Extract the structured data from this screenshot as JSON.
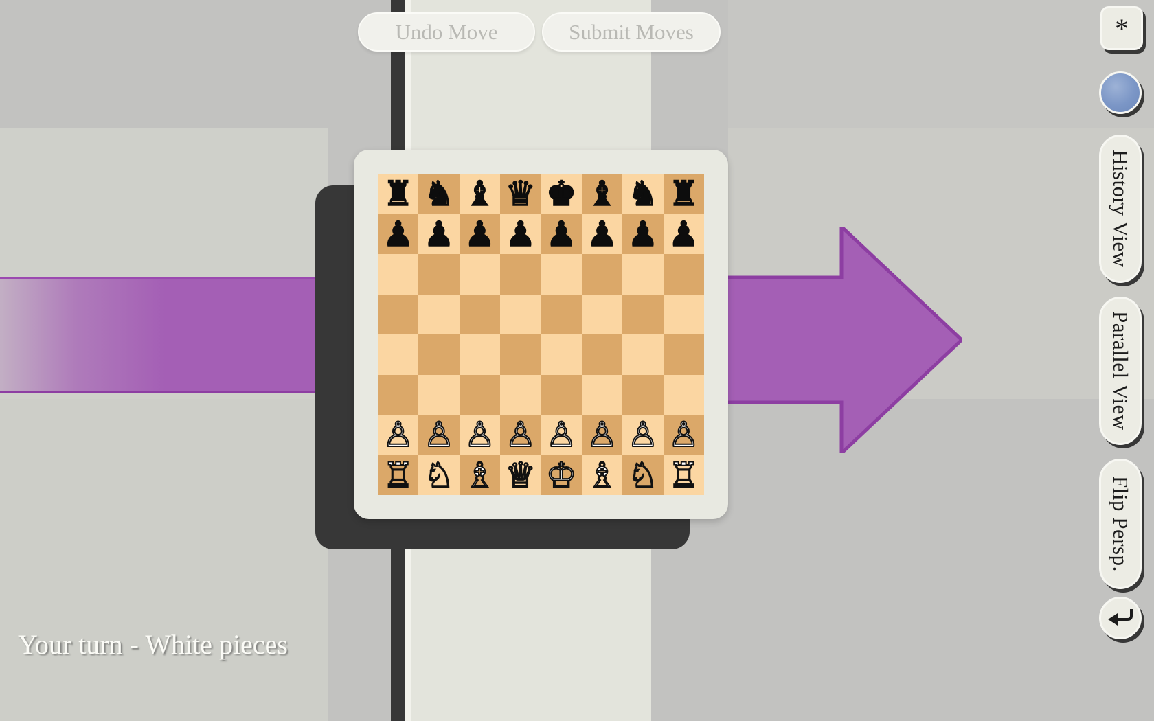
{
  "app": {
    "status_text": "Your turn - White pieces"
  },
  "toolbar": {
    "undo_label": "Undo Move",
    "submit_label": "Submit Moves"
  },
  "sidebar": {
    "items": [
      {
        "name": "settings",
        "label": "*",
        "icon": "asterisk-icon"
      },
      {
        "name": "marble",
        "label": "",
        "icon": "blue-sphere-icon"
      },
      {
        "name": "history",
        "label": "History View",
        "icon": ""
      },
      {
        "name": "parallel",
        "label": "Parallel View",
        "icon": ""
      },
      {
        "name": "flip",
        "label": "Flip Persp.",
        "icon": ""
      },
      {
        "name": "back",
        "label": "",
        "icon": "undo-arrow-icon"
      }
    ]
  },
  "colors": {
    "light_square": "#FBD6A2",
    "dark_square": "#DBA869",
    "board_frame": "#E8E9E1",
    "backplate": "#373737",
    "arrow_purple": "#A45FB5",
    "arrow_purple_stroke": "#8D3EA2",
    "background": "#C2C2C0",
    "marble_blue": "#7B96C6"
  },
  "board": {
    "orientation": "white-bottom",
    "ranks": [
      [
        "r",
        "n",
        "b",
        "q",
        "k",
        "b",
        "n",
        "r"
      ],
      [
        "p",
        "p",
        "p",
        "p",
        "p",
        "p",
        "p",
        "p"
      ],
      [
        "",
        "",
        "",
        "",
        "",
        "",
        "",
        ""
      ],
      [
        "",
        "",
        "",
        "",
        "",
        "",
        "",
        ""
      ],
      [
        "",
        "",
        "",
        "",
        "",
        "",
        "",
        ""
      ],
      [
        "",
        "",
        "",
        "",
        "",
        "",
        "",
        ""
      ],
      [
        "P",
        "P",
        "P",
        "P",
        "P",
        "P",
        "P",
        "P"
      ],
      [
        "R",
        "N",
        "B",
        "Q",
        "K",
        "B",
        "N",
        "R"
      ]
    ],
    "glyphs": {
      "r": "♜",
      "n": "♞",
      "b": "♝",
      "q": "♛",
      "k": "♚",
      "p": "♟",
      "R": "♖",
      "N": "♘",
      "B": "♗",
      "Q": "♕",
      "K": "♔",
      "P": "♙"
    },
    "piece_names": {
      "r": "black-rook",
      "n": "black-knight",
      "b": "black-bishop",
      "q": "black-queen",
      "k": "black-king",
      "p": "black-pawn",
      "R": "white-rook",
      "N": "white-knight",
      "B": "white-bishop",
      "Q": "white-queen",
      "K": "white-king",
      "P": "white-pawn"
    }
  }
}
